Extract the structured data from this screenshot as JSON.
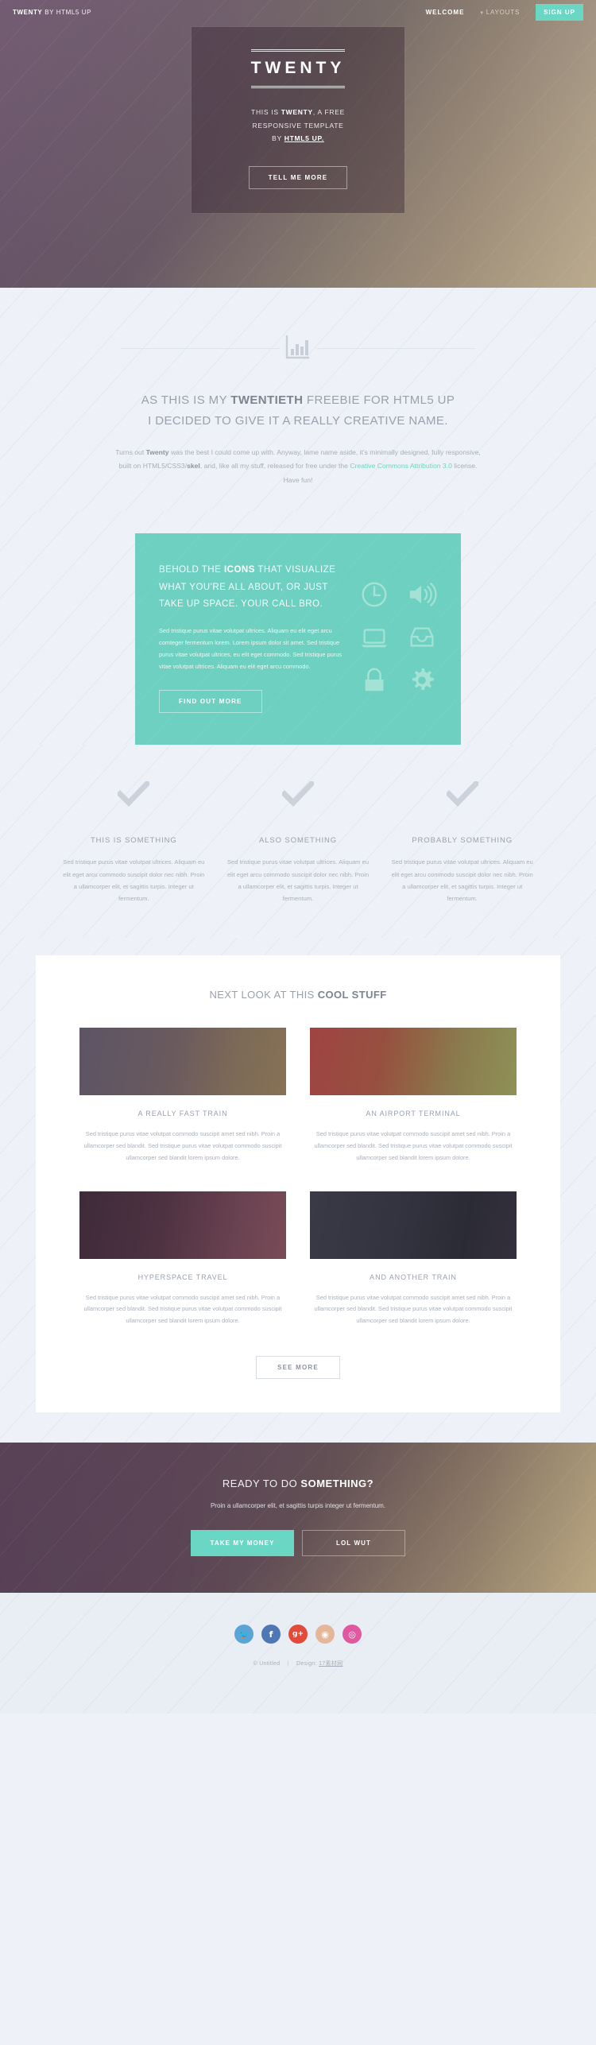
{
  "header": {
    "logo_strong": "TWENTY",
    "logo_normal": " BY HTML5 UP",
    "nav": [
      {
        "label": "WELCOME",
        "name": "nav-welcome"
      },
      {
        "label": "LAYOUTS",
        "name": "nav-layouts"
      }
    ],
    "signup_label": "SIGN UP",
    "caret_glyph": "▾"
  },
  "hero": {
    "title": "TWENTY",
    "line1_pre": "THIS IS ",
    "line1_strong": "TWENTY",
    "line1_post": ", A FREE",
    "line2": "RESPONSIVE TEMPLATE",
    "line3_pre": "BY ",
    "line3_strong": "HTML5 UP.",
    "button_label": "TELL ME MORE"
  },
  "intro": {
    "icon_name": "bar-chart-icon",
    "heading_part1": "AS THIS IS MY ",
    "heading_strong": "TWENTIETH",
    "heading_part2": " FREEBIE FOR HTML5 UP",
    "heading_line2": "I DECIDED TO GIVE IT A REALLY CREATIVE NAME.",
    "lead_a": "Turns out ",
    "lead_strong1": "Twenty",
    "lead_b": " was the best I could come up with. Anyway, lame name aside, it's minimally designed, fully responsive, built on HTML5/CSS3/",
    "lead_strong2": "skel",
    "lead_c": ", and, like all my stuff, released for free under the ",
    "lead_link": "Creative Commons Attribution 3.0",
    "lead_d": " license. Have fun!"
  },
  "teal": {
    "bg_color": "#6ed0c0",
    "heading_pre": "BEHOLD THE ",
    "heading_strong": "ICONS",
    "heading_post": " THAT VISUALIZE WHAT YOU'RE ALL ABOUT, OR JUST TAKE UP SPACE. YOUR CALL BRO.",
    "paragraph": "Sed tristique purus vitae volutpat ultrices. Aliquam eu elit eget arcu comteger fermentum lorem. Lorem ipsum dolor sit amet. Sed tristique purus vitae volutpat ultrices, eu elit eget commodo. Sed tristique purus vitae volutpat ultrices. Aliquam eu elit eget arcu commodo.",
    "button_label": "FIND OUT MORE",
    "icons": [
      "clock-icon",
      "volume-icon",
      "laptop-icon",
      "inbox-icon",
      "lock-icon",
      "gear-icon"
    ]
  },
  "features": {
    "items": [
      {
        "icon": "check-icon",
        "title": "THIS IS SOMETHING",
        "text": "Sed tristique purus vitae volutpat ultrices. Aliquam eu elit eget arcu commodo suscipit dolor nec nibh. Proin a ullamcorper elit, et sagittis turpis. Integer ut fermentum."
      },
      {
        "icon": "check-icon",
        "title": "ALSO SOMETHING",
        "text": "Sed tristique purus vitae volutpat ultrices. Aliquam eu elit eget arcu commodo suscipit dolor nec nibh. Proin a ullamcorper elit, et sagittis turpis. Integer ut fermentum."
      },
      {
        "icon": "check-icon",
        "title": "PROBABLY SOMETHING",
        "text": "Sed tristique purus vitae volutpat ultrices. Aliquam eu elit eget arcu commodo suscipit dolor nec nibh. Proin a ullamcorper elit, et sagittis turpis. Integer ut fermentum."
      }
    ]
  },
  "gallery": {
    "heading_pre": "NEXT LOOK AT THIS ",
    "heading_strong": "COOL STUFF",
    "items": [
      {
        "title": "A REALLY FAST TRAIN",
        "text": "Sed tristique purus vitae volutpat commodo suscipit amet sed nibh. Proin a ullamcorper sed blandit. Sed tristique purus vitae volutpat commodo suscipit ullamcorper sed blandit lorem ipsum dolore."
      },
      {
        "title": "AN AIRPORT TERMINAL",
        "text": "Sed tristique purus vitae volutpat commodo suscipit amet sed nibh. Proin a ullamcorper sed blandit. Sed tristique purus vitae volutpat commodo suscipit ullamcorper sed blandit lorem ipsum dolore."
      },
      {
        "title": "HYPERSPACE TRAVEL",
        "text": "Sed tristique purus vitae volutpat commodo suscipit amet sed nibh. Proin a ullamcorper sed blandit. Sed tristique purus vitae volutpat commodo suscipit ullamcorper sed blandit lorem ipsum dolore."
      },
      {
        "title": "AND ANOTHER TRAIN",
        "text": "Sed tristique purus vitae volutpat commodo suscipit amet sed nibh. Proin a ullamcorper sed blandit. Sed tristique purus vitae volutpat commodo suscipit ullamcorper sed blandit lorem ipsum dolore."
      }
    ],
    "button_label": "SEE MORE"
  },
  "cta": {
    "heading_pre": "READY TO DO ",
    "heading_strong": "SOMETHING?",
    "paragraph": "Proin a ullamcorper elit, et sagittis turpis integer ut fermentum.",
    "primary_label": "TAKE MY MONEY",
    "primary_color": "#6ad7c4",
    "secondary_label": "LOL WUT"
  },
  "footer": {
    "socials": [
      {
        "name": "twitter-icon",
        "glyph": "🐦",
        "color": "#5ba4d6"
      },
      {
        "name": "facebook-icon",
        "glyph": "f",
        "color": "#4f77b5"
      },
      {
        "name": "google-plus-icon",
        "glyph": "g+",
        "color": "#e24b3c"
      },
      {
        "name": "github-icon",
        "glyph": "◉",
        "color": "#e5b79a"
      },
      {
        "name": "dribbble-icon",
        "glyph": "◎",
        "color": "#e058a0"
      }
    ],
    "copyright": "© Untitled",
    "separator": "|",
    "design_label": "Design: ",
    "design_link": "17素材网"
  }
}
